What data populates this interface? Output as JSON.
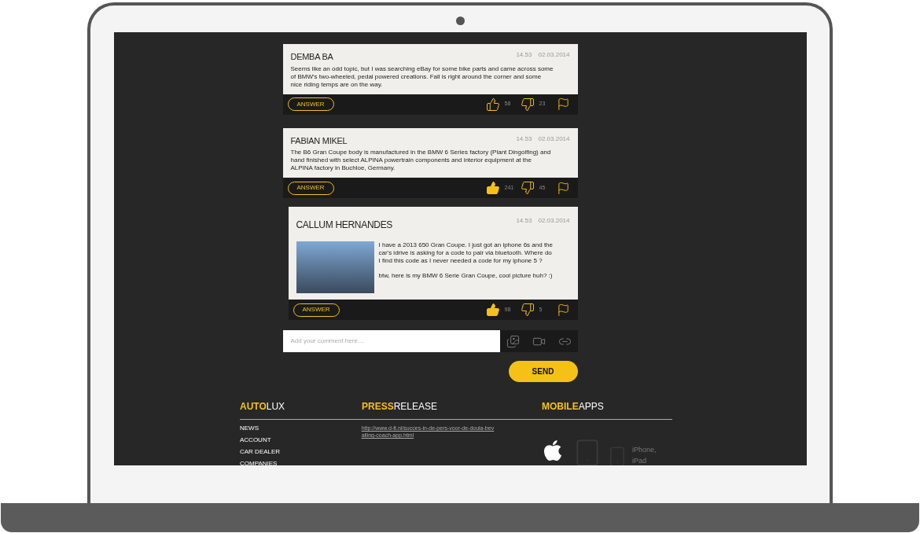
{
  "comments": [
    {
      "name": "DEMBA BA",
      "time": "14.53",
      "date": "02.03.2014",
      "text": [
        "Seems like an odd topic, but I was searching eBay for some bike parts and came across some of BMW's two-wheeled, pedal powered creations. Fall is right around the corner and some nice riding temps are on the way."
      ],
      "answer": "ANSWER",
      "likes": "58",
      "liked": false,
      "dislikes": "23"
    },
    {
      "name": "FABIAN MIKEL",
      "time": "14.53",
      "date": "02.03.2014",
      "text": [
        "The B6 Gran Coupe body is manufactured in the BMW 6 Series factory (Plant Dingolfing) and hand finished with select ALPINA powertrain components and interior equipment at the ALPINA factory in Buchloe, Germany."
      ],
      "answer": "ANSWER",
      "likes": "241",
      "liked": true,
      "dislikes": "45",
      "children": [
        {
          "name": "CALLUM HERNANDES",
          "time": "14.53",
          "date": "02.03.2014",
          "has_photo": true,
          "text": [
            "I have a 2013 650 Gran Coupe. I just got an iphone 6s and the car's idrive is asking for a code to pair via bluetooth. Where do I find this code as I never needed a code for my iphone 5 ?",
            "btw, here is my BMW 6 Serie Gran Coupe, cool picture huh? :)"
          ],
          "answer": "ANSWER",
          "likes": "98",
          "liked": true,
          "dislikes": "5"
        }
      ]
    }
  ],
  "comment_form": {
    "placeholder": "Add your comment here....",
    "send": "SEND"
  },
  "footer": {
    "autolux": {
      "accent": "AUTO",
      "rest": "LUX",
      "links": [
        "NEWS",
        "ACCOUNT",
        "CAR DEALER",
        "COMPANIES"
      ]
    },
    "press": {
      "accent": "PRESS",
      "rest": "RELEASE",
      "link": "http://www.d-tt.nl/succes-in-de-pers-voor-de-doula-bevalling-coach-app.html"
    },
    "apps": {
      "accent": "MOBILE",
      "rest": "APPS",
      "caption": "iPhone, iPad"
    }
  }
}
